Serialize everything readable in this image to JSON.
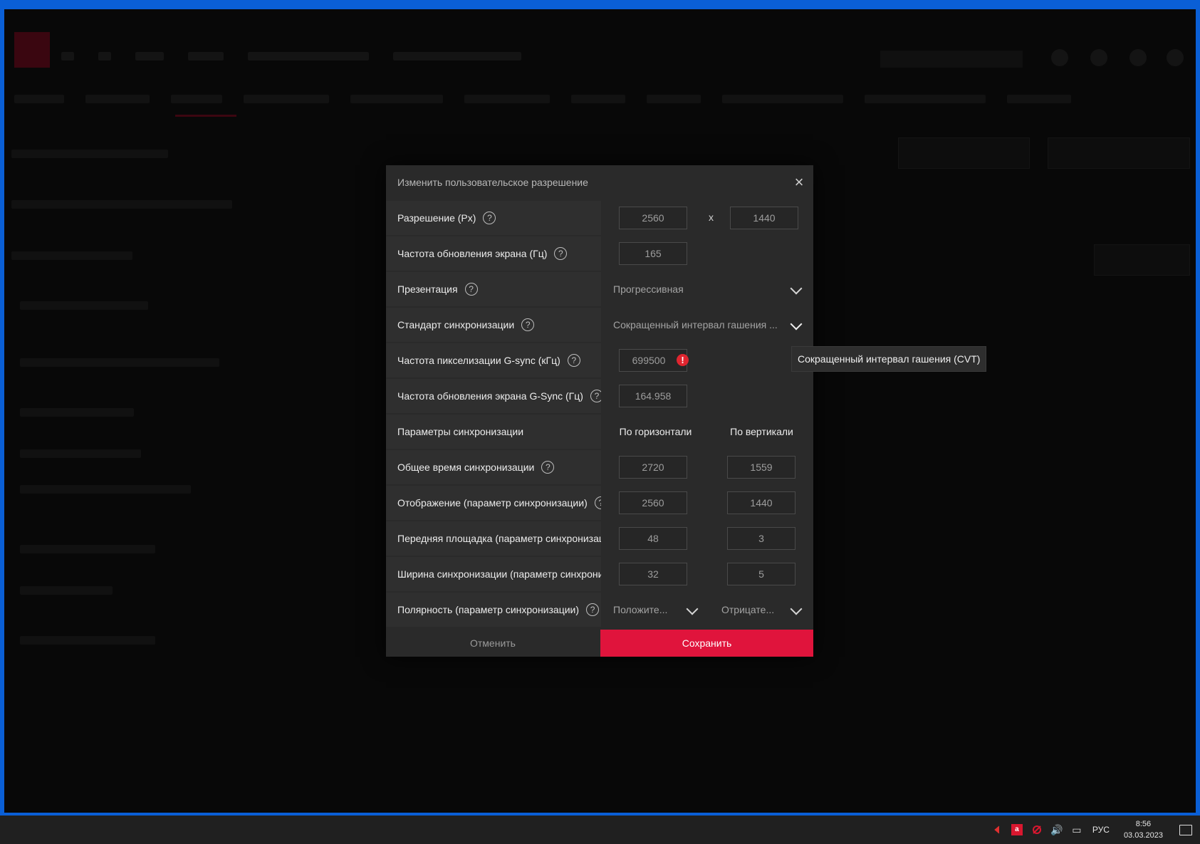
{
  "dialog": {
    "title": "Изменить пользовательское разрешение",
    "rows": {
      "resolution": {
        "label": "Разрешение (Px)",
        "width": "2560",
        "separator": "x",
        "height": "1440"
      },
      "refresh_rate": {
        "label": "Частота обновления экрана (Гц)",
        "value": "165"
      },
      "presentation": {
        "label": "Презентация",
        "value": "Прогрессивная"
      },
      "timing_standard": {
        "label": "Стандарт синхронизации",
        "value": "Сокращенный интервал гашения ..."
      },
      "gsync_pixel_clock": {
        "label": "Частота пикселизации G-sync (кГц)",
        "value": "699500",
        "error_icon": "!"
      },
      "gsync_refresh": {
        "label": "Частота обновления экрана G-Sync (Гц)",
        "value": "164.958"
      },
      "timing_params": {
        "label": "Параметры синхронизации",
        "horizontal": "По горизонтали",
        "vertical": "По вертикали"
      },
      "total_timing": {
        "label": "Общее время синхронизации",
        "horizontal": "2720",
        "vertical": "1559"
      },
      "display_timing": {
        "label": "Отображение (параметр синхронизации)",
        "horizontal": "2560",
        "vertical": "1440"
      },
      "front_porch": {
        "label": "Передняя площадка (параметр синхронизац",
        "horizontal": "48",
        "vertical": "3"
      },
      "sync_width": {
        "label": "Ширина синхронизации (параметр синхрони",
        "horizontal": "32",
        "vertical": "5"
      },
      "polarity": {
        "label": "Полярность (параметр синхронизации)",
        "horizontal": "Положите...",
        "vertical": "Отрицате..."
      }
    },
    "help_glyph": "?",
    "close_glyph": "×",
    "cancel_label": "Отменить",
    "save_label": "Сохранить"
  },
  "tooltip": {
    "text": "Сокращенный интервал гашения (CVT)"
  },
  "taskbar": {
    "amd_glyph": "a",
    "volume_glyph": "🔊",
    "network_glyph": "▭",
    "language": "РУС",
    "time": "8:56",
    "date": "03.03.2023"
  },
  "colors": {
    "accent": "#e0143c",
    "error": "#e0252f",
    "desktop": "#0a5fd6"
  }
}
